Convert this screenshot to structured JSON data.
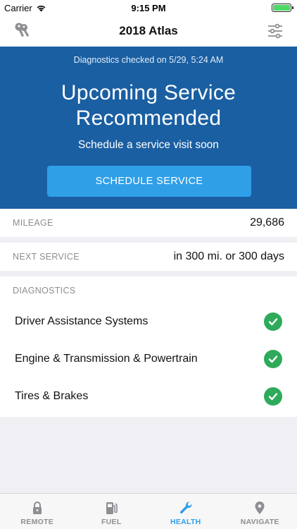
{
  "status_bar": {
    "carrier": "Carrier",
    "time": "9:15 PM",
    "battery_level": 1.0
  },
  "nav": {
    "title": "2018 Atlas",
    "left_icon": "keys-icon",
    "right_icon": "sliders-icon"
  },
  "hero": {
    "checked_text": "Diagnostics checked on 5/29, 5:24 AM",
    "title_line1": "Upcoming Service",
    "title_line2": "Recommended",
    "subtitle": "Schedule a service visit soon",
    "button_label": "SCHEDULE SERVICE",
    "background_color": "#1a5fa2",
    "button_color": "#2f9fe8"
  },
  "mileage": {
    "label": "MILEAGE",
    "value": "29,686"
  },
  "next_service": {
    "label": "NEXT SERVICE",
    "value": "in 300 mi. or 300 days"
  },
  "diagnostics": {
    "header": "DIAGNOSTICS",
    "items": [
      {
        "name": "Driver Assistance Systems",
        "status": "ok"
      },
      {
        "name": "Engine & Transmission & Powertrain",
        "status": "ok"
      },
      {
        "name": "Tires & Brakes",
        "status": "ok"
      }
    ],
    "ok_color": "#2eaa5a"
  },
  "tabs": [
    {
      "label": "REMOTE",
      "icon": "lock-icon",
      "active": false
    },
    {
      "label": "FUEL",
      "icon": "fuel-pump-icon",
      "active": false
    },
    {
      "label": "HEALTH",
      "icon": "wrench-icon",
      "active": true
    },
    {
      "label": "NAVIGATE",
      "icon": "map-pin-icon",
      "active": false
    }
  ]
}
